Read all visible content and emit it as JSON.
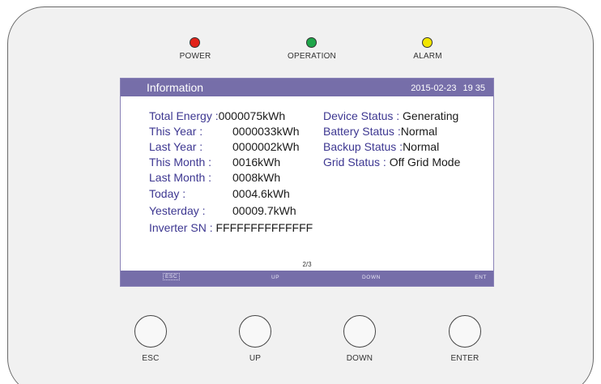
{
  "indicators": [
    {
      "label": "POWER",
      "color": "#e2231a"
    },
    {
      "label": "OPERATION",
      "color": "#1fa64a"
    },
    {
      "label": "ALARM",
      "color": "#f2e600"
    }
  ],
  "screen": {
    "title": "Information",
    "date": "2015-02-23",
    "time": "19 35",
    "left_items": [
      {
        "label": "Total Energy :",
        "value": "0000075kWh"
      },
      {
        "label": "This Year :",
        "value": "0000033kWh"
      },
      {
        "label": "Last Year :",
        "value": "0000002kWh"
      },
      {
        "label": "This Month :",
        "value": "0016kWh"
      },
      {
        "label": "Last Month :",
        "value": "0008kWh"
      },
      {
        "label": "Today :",
        "value": "0004.6kWh"
      },
      {
        "label": "Yesterday :",
        "value": "00009.7kWh"
      },
      {
        "label": "Inverter SN :",
        "value": "FFFFFFFFFFFFFF"
      }
    ],
    "right_items": [
      {
        "label": "Device Status :",
        "value": "Generating"
      },
      {
        "label": "Battery Status :",
        "value": "Normal"
      },
      {
        "label": "Backup Status :",
        "value": "Normal"
      },
      {
        "label": "Grid Status :",
        "value": "Off Grid Mode"
      }
    ],
    "page_indicator": "2/3",
    "softkeys": [
      "ESC",
      "UP",
      "DOWN",
      "ENT"
    ]
  },
  "buttons": [
    "ESC",
    "UP",
    "DOWN",
    "ENTER"
  ]
}
